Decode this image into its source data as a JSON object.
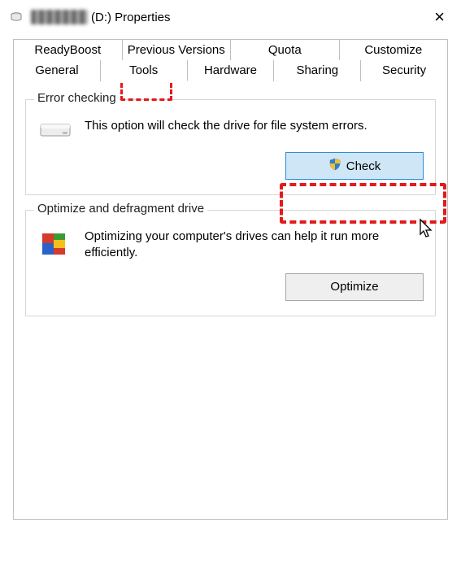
{
  "window": {
    "title_suffix": "(D:) Properties",
    "close_label": "×"
  },
  "tabs": {
    "row1": [
      "ReadyBoost",
      "Previous Versions",
      "Quota",
      "Customize"
    ],
    "row2": [
      "General",
      "Tools",
      "Hardware",
      "Sharing",
      "Security"
    ],
    "active": "Tools"
  },
  "groups": {
    "error_check": {
      "title": "Error checking",
      "desc": "This option will check the drive for file system errors.",
      "button": "Check",
      "icon": "drive-icon",
      "button_icon": "uac-shield-icon"
    },
    "optimize": {
      "title": "Optimize and defragment drive",
      "desc": "Optimizing your computer's drives can help it run more efficiently.",
      "button": "Optimize",
      "icon": "defrag-icon"
    }
  },
  "colors": {
    "highlight": "#e21a1a",
    "button_active_bg": "#cfe6f7",
    "button_active_border": "#2d8bd8"
  }
}
